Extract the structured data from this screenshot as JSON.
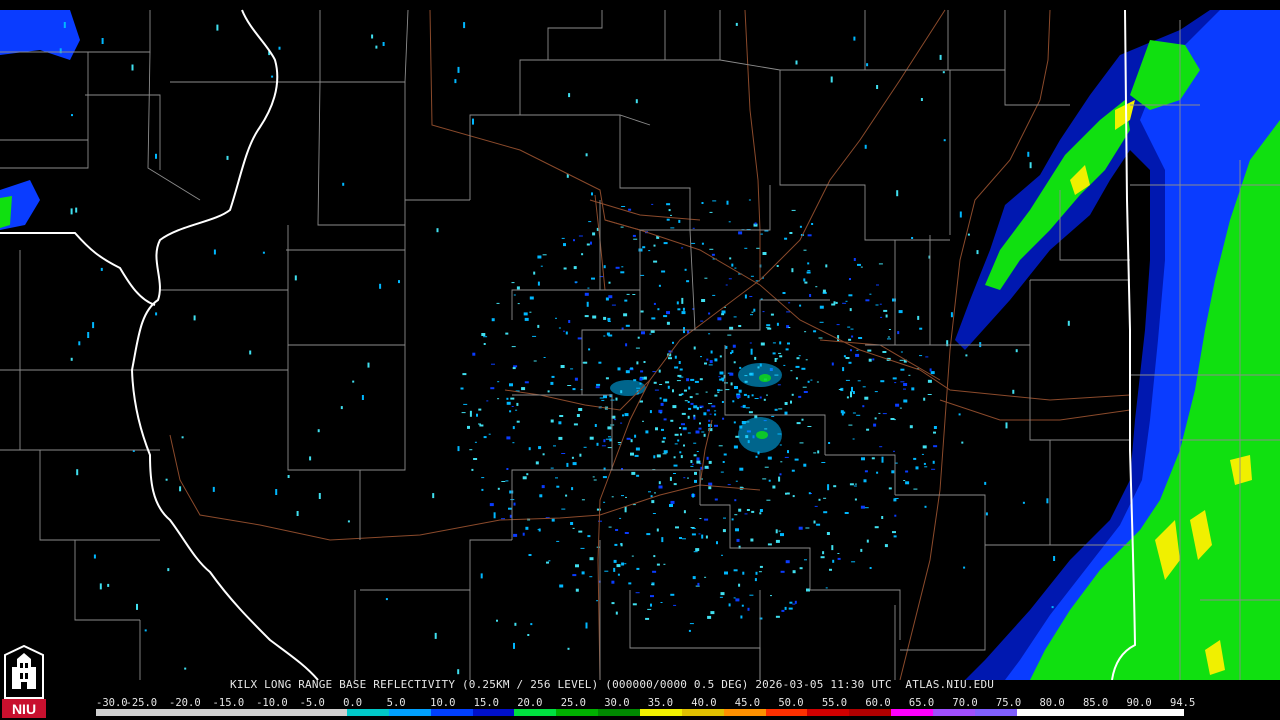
{
  "product": {
    "caption": "KILX LONG RANGE BASE REFLECTIVITY (0.25KM / 256 LEVEL) (000000/0000 0.5 DEG) 2026-03-05 11:30 UTC  ATLAS.NIU.EDU"
  },
  "logo": {
    "text": "NIU",
    "colors": {
      "red": "#c8102e",
      "white": "#ffffff",
      "black": "#000000"
    }
  },
  "scale": {
    "labels": [
      "-30.0",
      "-25.0",
      "-20.0",
      "-15.0",
      "-10.0",
      "-5.0",
      "0.0",
      "5.0",
      "10.0",
      "15.0",
      "20.0",
      "25.0",
      "30.0",
      "35.0",
      "40.0",
      "45.0",
      "50.0",
      "55.0",
      "60.0",
      "65.0",
      "70.0",
      "75.0",
      "80.0",
      "85.0",
      "90.0",
      "94.5"
    ],
    "colors": [
      "#cfcfcf",
      "#cfcfcf",
      "#cfcfcf",
      "#cfcfcf",
      "#cfcfcf",
      "#cfcfcf",
      "#00c8c8",
      "#00a0ff",
      "#0040ff",
      "#0010c8",
      "#00e040",
      "#00b000",
      "#008800",
      "#f0f000",
      "#e0c000",
      "#ff9000",
      "#ff3000",
      "#d00000",
      "#b00000",
      "#ff00ff",
      "#a050ff",
      "#8060ff",
      "#ffffff",
      "#ffffff",
      "#ffffff",
      "#ffffff"
    ]
  },
  "map_colors": {
    "background": "#000000",
    "county_lines": "#8c8c8c",
    "state_lines": "#ffffff",
    "roads": "#8b4a2b",
    "echo_light": "#00b8ff",
    "echo_cyan": "#40e0f0",
    "echo_blue": "#0a3cff",
    "echo_darkblue": "#0018b0",
    "echo_green": "#10e010",
    "echo_darkgreen": "#00a800",
    "echo_yellow": "#f0f000"
  }
}
